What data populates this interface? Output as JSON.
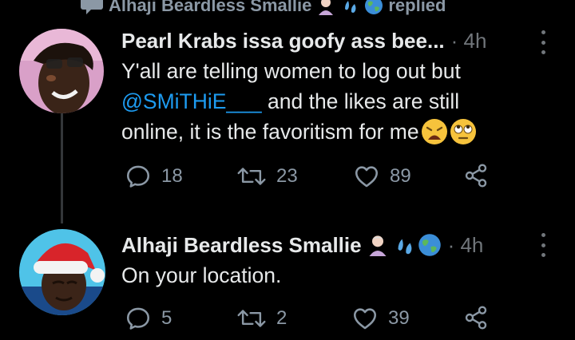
{
  "social_context": {
    "name": "Alhaji Beardless Smallie",
    "action": "replied"
  },
  "tweets": [
    {
      "display_name": "Pearl Krabs issa goofy ass bee...",
      "time": "· 4h",
      "text_line1": "Y'all are telling women to log out but",
      "mention": "@SMiTHiE___",
      "text_line2_rest": " and the likes are still",
      "text_line3": "online, it is the favoritism for me",
      "replies": "18",
      "retweets": "23",
      "likes": "89"
    },
    {
      "display_name": "Alhaji Beardless Smallie",
      "time": "· 4h",
      "text": "On your location.",
      "replies": "5",
      "retweets": "2",
      "likes": "39"
    }
  ],
  "colors": {
    "background": "#000000",
    "text": "#e7e9ea",
    "secondary": "#71767b",
    "link": "#1d9bf0"
  },
  "icons": [
    "speech-bubble-icon",
    "person-emoji-icon",
    "sweat-droplets-emoji-icon",
    "globe-emoji-icon",
    "weary-face-emoji-icon",
    "eye-roll-emoji-icon",
    "reply-icon",
    "retweet-icon",
    "like-icon",
    "share-icon",
    "more-icon"
  ]
}
